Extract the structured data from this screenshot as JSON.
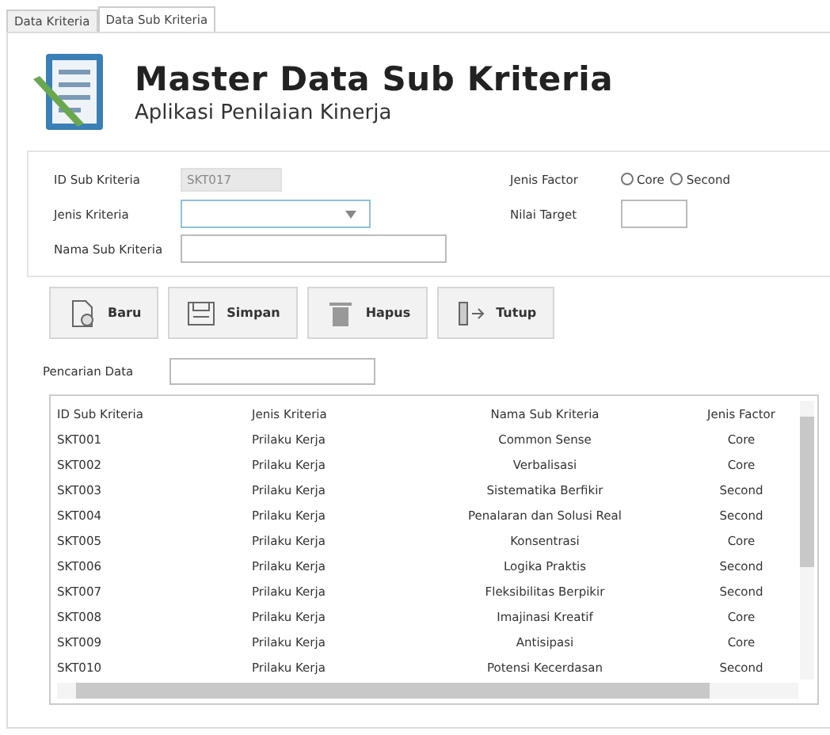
{
  "tabs": [
    {
      "label": "Data Kriteria",
      "selected": false
    },
    {
      "label": "Data Sub Kriteria",
      "selected": true
    }
  ],
  "header": {
    "title": "Master Data Sub Kriteria",
    "subtitle": "Aplikasi Penilaian Kinerja"
  },
  "form": {
    "id_label": "ID Sub Kriteria",
    "id_value": "SKT017",
    "jenis_label": "Jenis Kriteria",
    "nama_label": "Nama Sub Kriteria",
    "factor_label": "Jenis Factor",
    "factor_options": [
      {
        "label": "Core",
        "selected": false
      },
      {
        "label": "Second",
        "selected": false
      }
    ],
    "target_label": "Nilai Target"
  },
  "buttons": [
    {
      "label": "Baru",
      "kind": "new"
    },
    {
      "label": "Simpan",
      "kind": "save"
    },
    {
      "label": "Hapus",
      "kind": "delete"
    },
    {
      "label": "Tutup",
      "kind": "close"
    }
  ],
  "search": {
    "label": "Pencarian Data"
  },
  "table": {
    "columns": [
      "ID Sub Kriteria",
      "Jenis Kriteria",
      "Nama Sub Kriteria",
      "Jenis Factor"
    ],
    "rows": [
      [
        "SKT001",
        "Prilaku Kerja",
        "Common Sense",
        "Core"
      ],
      [
        "SKT002",
        "Prilaku Kerja",
        "Verbalisasi",
        "Core"
      ],
      [
        "SKT003",
        "Prilaku Kerja",
        "Sistematika Berfikir",
        "Second"
      ],
      [
        "SKT004",
        "Prilaku Kerja",
        "Penalaran dan Solusi Real",
        "Second"
      ],
      [
        "SKT005",
        "Prilaku Kerja",
        "Konsentrasi",
        "Core"
      ],
      [
        "SKT006",
        "Prilaku Kerja",
        "Logika Praktis",
        "Second"
      ],
      [
        "SKT007",
        "Prilaku Kerja",
        "Fleksibilitas Berpikir",
        "Second"
      ],
      [
        "SKT008",
        "Prilaku Kerja",
        "Imajinasi Kreatif",
        "Core"
      ],
      [
        "SKT009",
        "Prilaku Kerja",
        "Antisipasi",
        "Core"
      ],
      [
        "SKT010",
        "Prilaku Kerja",
        "Potensi Kecerdasan",
        "Second"
      ]
    ]
  }
}
